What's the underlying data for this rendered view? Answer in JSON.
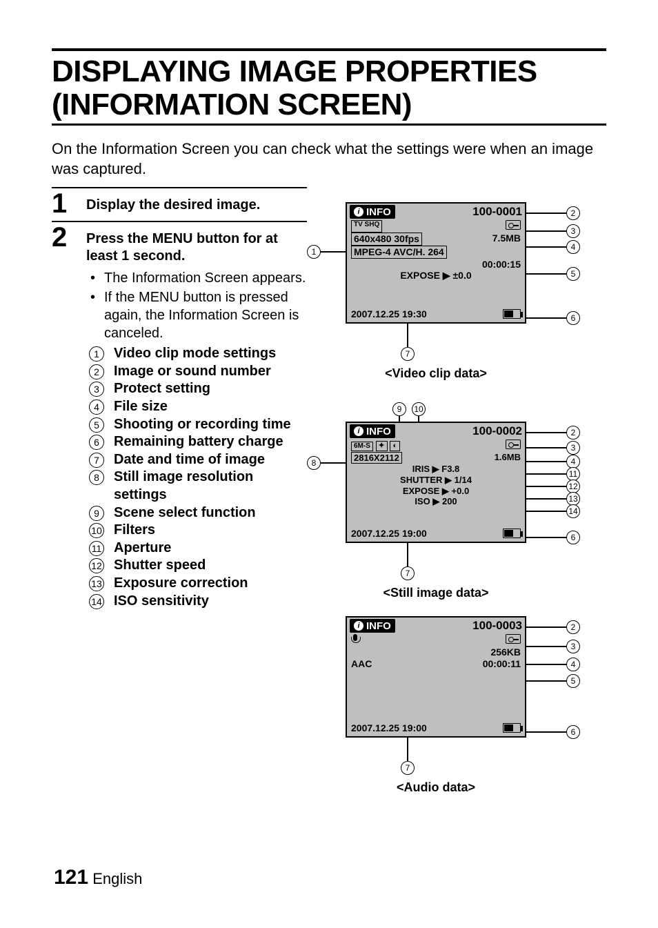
{
  "title_line1": "DISPLAYING IMAGE PROPERTIES",
  "title_line2": "(INFORMATION SCREEN)",
  "intro": "On the Information Screen you can check what the settings were when an image was captured.",
  "steps": {
    "s1": {
      "num": "1",
      "heading": "Display the desired image."
    },
    "s2": {
      "num": "2",
      "heading": "Press the MENU button for at least 1 second.",
      "bullets": [
        "The Information Screen appears.",
        "If the MENU button is pressed again, the Information Screen is canceled."
      ]
    }
  },
  "legend": [
    "Video clip mode settings",
    "Image or sound number",
    "Protect setting",
    "File size",
    "Shooting or recording time",
    "Remaining battery charge",
    "Date and time of image",
    "Still image resolution settings",
    "Scene select function",
    "Filters",
    "Aperture",
    "Shutter speed",
    "Exposure correction",
    "ISO sensitivity"
  ],
  "screens": {
    "video": {
      "info_label": "INFO",
      "number": "100-0001",
      "mode_badge": "TV SHQ",
      "resolution": "640x480 30fps",
      "codec": "MPEG-4 AVC/H. 264",
      "filesize": "7.5MB",
      "rectime": "00:00:15",
      "expose_label": "EXPOSE",
      "expose_value": "±0.0",
      "datetime": "2007.12.25 19:30",
      "caption": "<Video clip data>"
    },
    "still": {
      "info_label": "INFO",
      "number": "100-0002",
      "res_badge": "6M-S",
      "resolution": "2816X2112",
      "filesize": "1.6MB",
      "iris_label": "IRIS",
      "iris_value": "F3.8",
      "shutter_label": "SHUTTER",
      "shutter_value": "1/14",
      "expose_label": "EXPOSE",
      "expose_value": "+0.0",
      "iso_label": "ISO",
      "iso_value": "200",
      "datetime": "2007.12.25 19:00",
      "caption": "<Still image data>"
    },
    "audio": {
      "info_label": "INFO",
      "number": "100-0003",
      "codec": "AAC",
      "filesize": "256KB",
      "rectime": "00:00:11",
      "datetime": "2007.12.25 19:00",
      "caption": "<Audio data>"
    }
  },
  "footer": {
    "page": "121",
    "lang": "English"
  }
}
